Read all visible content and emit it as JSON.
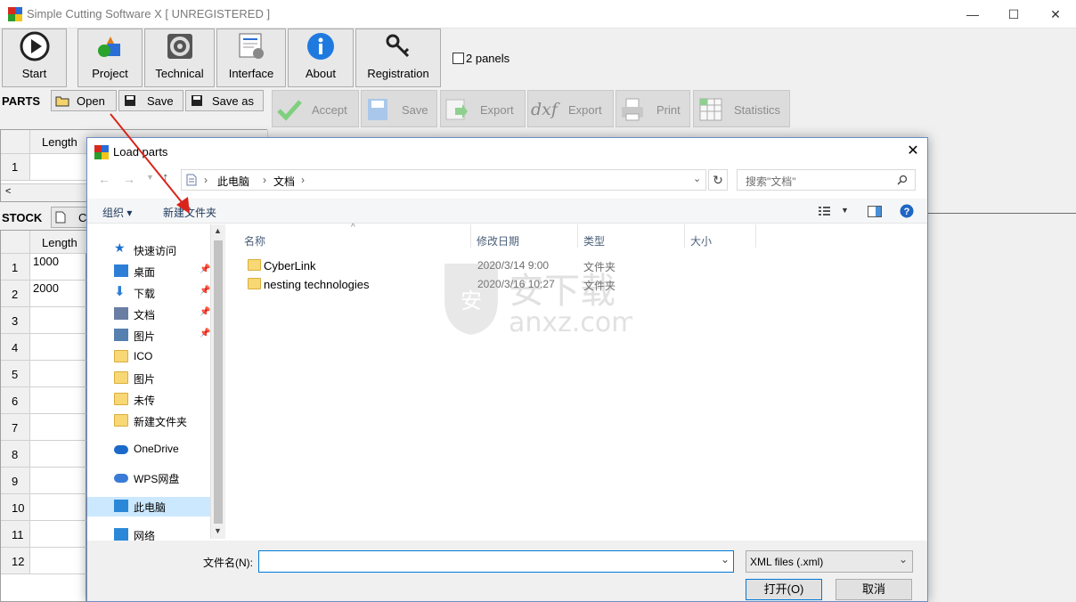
{
  "window": {
    "title": "Simple Cutting Software X [ UNREGISTERED ]",
    "controls": {
      "minimize": "—",
      "maximize": "☐",
      "close": "✕"
    }
  },
  "toolbar": {
    "buttons": [
      {
        "label": "Start",
        "icon": "play-icon"
      },
      {
        "label": "Project",
        "icon": "project-icon"
      },
      {
        "label": "Technical",
        "icon": "gear-icon"
      },
      {
        "label": "Interface",
        "icon": "interface-icon"
      },
      {
        "label": "About",
        "icon": "info-icon"
      },
      {
        "label": "Registration",
        "icon": "key-icon"
      }
    ],
    "two_panels": {
      "label": "2 panels",
      "checked": false
    }
  },
  "parts": {
    "section_label": "PARTS",
    "open_label": "Open",
    "save_label": "Save",
    "save_as_label": "Save as",
    "accept_label": "Accept",
    "save2_label": "Save",
    "export_label": "Export",
    "export_dxf_label": "Export",
    "dxf_text": "dxf",
    "print_label": "Print",
    "statistics_label": "Statistics",
    "grid_header": "Length",
    "rows": [
      "1"
    ]
  },
  "stock": {
    "section_label": "STOCK",
    "tab_partial": "C",
    "grid_header": "Length",
    "rows": [
      {
        "num": "1",
        "length": "1000"
      },
      {
        "num": "2",
        "length": "2000"
      },
      {
        "num": "3",
        "length": ""
      },
      {
        "num": "4",
        "length": ""
      },
      {
        "num": "5",
        "length": ""
      },
      {
        "num": "6",
        "length": ""
      },
      {
        "num": "7",
        "length": ""
      },
      {
        "num": "8",
        "length": ""
      },
      {
        "num": "9",
        "length": ""
      },
      {
        "num": "10",
        "length": ""
      },
      {
        "num": "11",
        "length": ""
      },
      {
        "num": "12",
        "length": ""
      }
    ]
  },
  "dialog": {
    "title": "Load parts",
    "breadcrumb": [
      "此电脑",
      "文档"
    ],
    "search_placeholder": "搜索\"文档\"",
    "organize_label": "组织 ▾",
    "new_folder_label": "新建文件夹",
    "nav_items": [
      {
        "label": "快速访问",
        "icon": "star-icon",
        "color": "#1e6fd0"
      },
      {
        "label": "桌面",
        "icon": "desktop-icon",
        "color": "#2d7fd6"
      },
      {
        "label": "下载",
        "icon": "download-icon",
        "color": "#2d7fd6"
      },
      {
        "label": "文档",
        "icon": "document-icon",
        "color": "#6a7ea3"
      },
      {
        "label": "图片",
        "icon": "picture-icon",
        "color": "#5580b0"
      },
      {
        "label": "ICO",
        "icon": "folder-icon",
        "color": "#f8d775"
      },
      {
        "label": "图片",
        "icon": "folder-icon",
        "color": "#f8d775"
      },
      {
        "label": "未传",
        "icon": "folder-icon",
        "color": "#f8d775"
      },
      {
        "label": "新建文件夹",
        "icon": "folder-icon",
        "color": "#f8d775"
      },
      {
        "label": "OneDrive",
        "icon": "cloud-icon",
        "color": "#1b6ac9"
      },
      {
        "label": "WPS网盘",
        "icon": "cloud-outline-icon",
        "color": "#3a7bd5"
      },
      {
        "label": "此电脑",
        "icon": "computer-icon",
        "color": "#2b88d8"
      },
      {
        "label": "网络",
        "icon": "network-icon",
        "color": "#2b88d8"
      }
    ],
    "columns": [
      "名称",
      "修改日期",
      "类型",
      "大小"
    ],
    "files": [
      {
        "name": "CyberLink",
        "date": "2020/3/14 9:00",
        "type": "文件夹"
      },
      {
        "name": "nesting technologies",
        "date": "2020/3/16 10:27",
        "type": "文件夹"
      }
    ],
    "filename_label": "文件名(N):",
    "filename_value": "",
    "filetype_value": "XML files (.xml)",
    "open_button": "打开(O)",
    "cancel_button": "取消"
  },
  "watermark": {
    "text": "anxz.com",
    "cn_text": "安下载",
    "badge": "安"
  },
  "colors": {
    "accent": "#0078d7",
    "arrow": "#d9241b",
    "folder": "#f8d775"
  }
}
